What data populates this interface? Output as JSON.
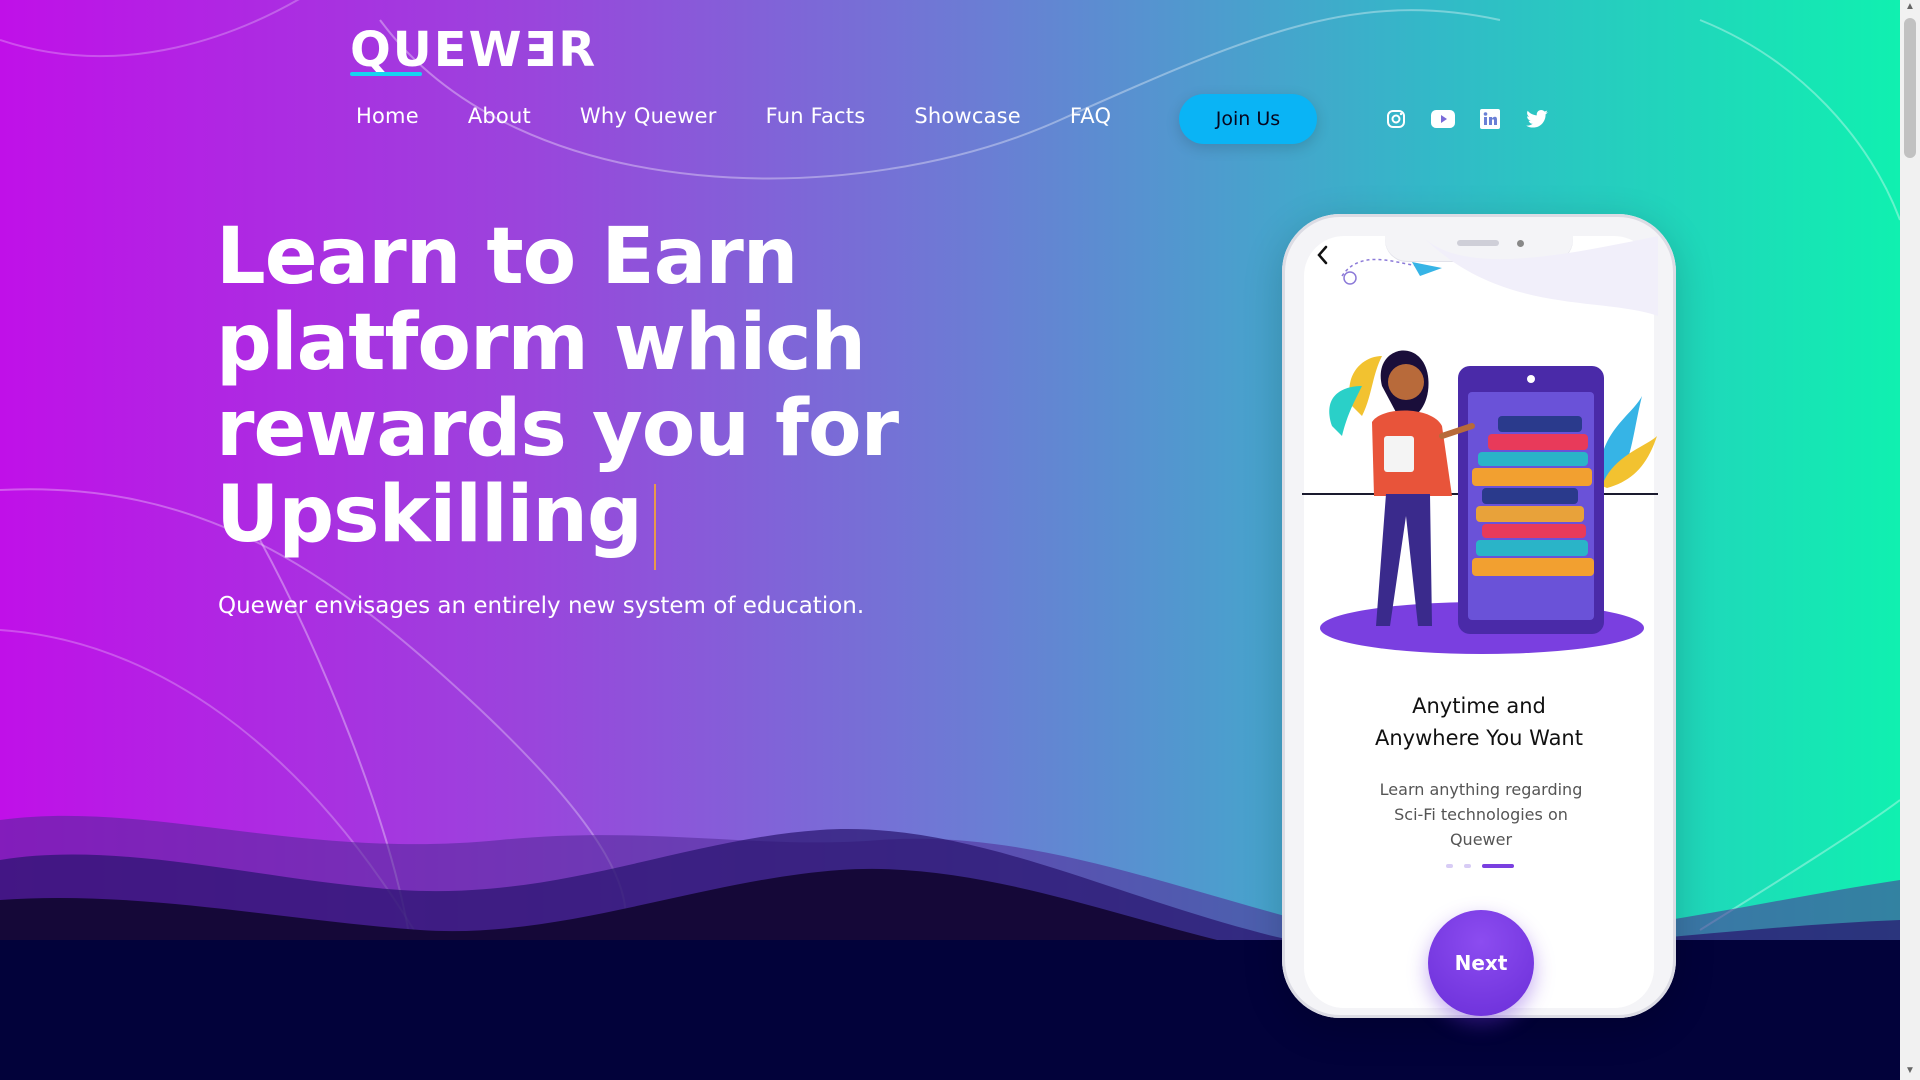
{
  "brand": {
    "logo_text": "QUEWƎR"
  },
  "nav": {
    "items": [
      {
        "label": "Home"
      },
      {
        "label": "About"
      },
      {
        "label": "Why Quewer"
      },
      {
        "label": "Fun Facts"
      },
      {
        "label": "Showcase"
      },
      {
        "label": "FAQ"
      }
    ],
    "join_label": "Join Us"
  },
  "socials": [
    "instagram-icon",
    "youtube-icon",
    "linkedin-icon",
    "twitter-icon"
  ],
  "hero": {
    "headline_lines": [
      "Learn to Earn",
      "platform which",
      "rewards you for",
      "Upskilling"
    ],
    "subtitle": "Quewer envisages an entirely new system of education."
  },
  "phone": {
    "title_line1": "Anytime and",
    "title_line2": "Anywhere You Want",
    "description": "Learn anything regarding Sci-Fi technologies on Quewer",
    "carousel_position": {
      "current": 3,
      "total": 3
    },
    "next_label": "Next"
  },
  "colors": {
    "gradient_start": "#c010e8",
    "gradient_end": "#10f0b0",
    "accent_button": "#0ab4f5",
    "next_button": "#7a3fe0",
    "bottom_band": "#02023a"
  }
}
